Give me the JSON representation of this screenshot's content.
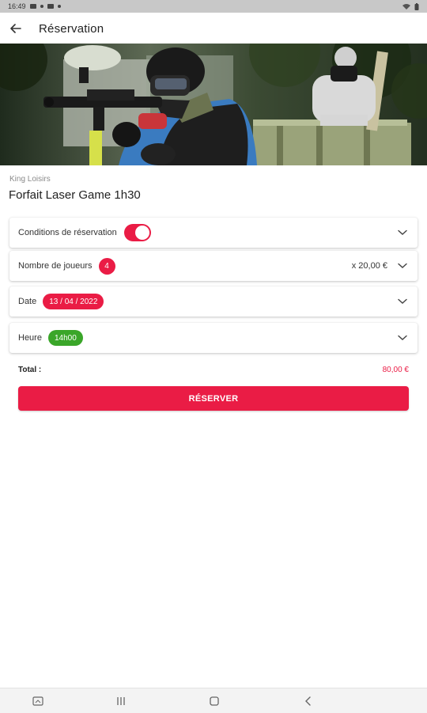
{
  "status_bar": {
    "time": "16:49"
  },
  "app_bar": {
    "title": "Réservation",
    "back_icon": "arrow-left-icon"
  },
  "product": {
    "venue": "King Loisirs",
    "title": "Forfait Laser Game 1h30"
  },
  "options": {
    "conditions": {
      "label": "Conditions de réservation",
      "accepted": true
    },
    "players": {
      "label": "Nombre de joueurs",
      "count": "4",
      "unit_price": "x 20,00 €"
    },
    "date": {
      "label": "Date",
      "value": "13 / 04 / 2022"
    },
    "time": {
      "label": "Heure",
      "value": "14h00"
    }
  },
  "total": {
    "label": "Total :",
    "value": "80,00 €"
  },
  "reserve_button": {
    "label": "RÉSERVER"
  },
  "colors": {
    "accent": "#ea1c45",
    "success": "#3aa629"
  },
  "nav_bar": {
    "icons": [
      "screenshot-icon",
      "recent-apps-icon",
      "home-icon",
      "back-icon"
    ]
  }
}
